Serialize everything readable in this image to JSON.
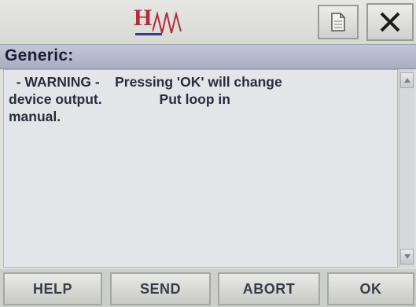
{
  "titlebar": {
    "logo_letter": "H",
    "doc_icon": "document-icon",
    "close_icon": "close-icon",
    "close_glyph": "✕"
  },
  "header": {
    "title": "Generic:"
  },
  "message": {
    "text": "  - WARNING -    Pressing 'OK' will change\ndevice output.               Put loop in\nmanual."
  },
  "scrollbar": {
    "up_icon": "arrow-up-icon",
    "down_icon": "arrow-down-icon"
  },
  "softkeys": {
    "help": "HELP",
    "send": "SEND",
    "abort": "ABORT",
    "ok": "OK"
  },
  "colors": {
    "logo_red": "#b42a3a",
    "header_blue": "#a9adc2",
    "text_dark": "#2a2d3a"
  }
}
